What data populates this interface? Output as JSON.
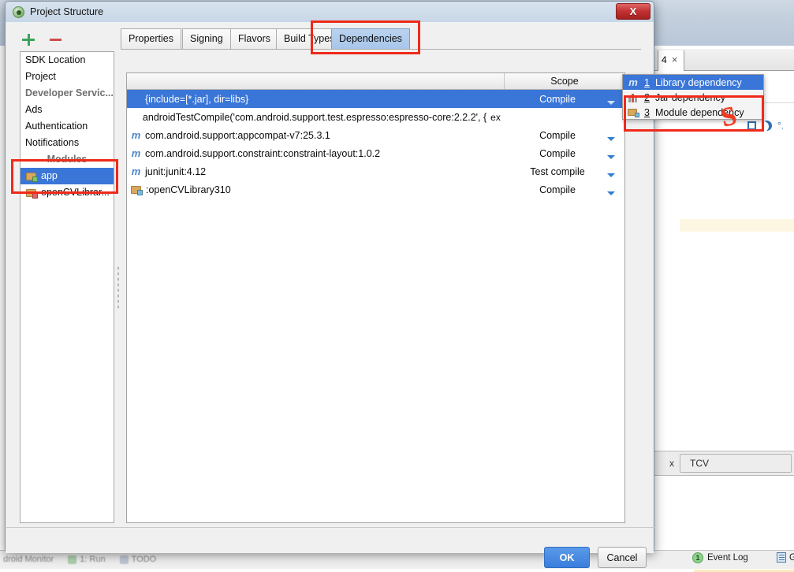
{
  "dialog": {
    "title": "Project Structure",
    "app_icon": "android-studio-icon",
    "close_label": "X",
    "toolbar": {
      "add_label": "+",
      "remove_label": "−"
    },
    "sidebar": {
      "items": [
        {
          "label": "SDK Location",
          "type": "item"
        },
        {
          "label": "Project",
          "type": "item"
        },
        {
          "label": "Developer Servic...",
          "type": "item-bold"
        },
        {
          "label": "Ads",
          "type": "item"
        },
        {
          "label": "Authentication",
          "type": "item"
        },
        {
          "label": "Notifications",
          "type": "item"
        }
      ],
      "group_label": "Modules",
      "modules": [
        {
          "label": "app",
          "selected": true,
          "icon": "module-app-icon"
        },
        {
          "label": "openCVLibrar...",
          "selected": false,
          "icon": "module-library-icon"
        }
      ]
    },
    "tabs": [
      {
        "label": "Properties",
        "active": false
      },
      {
        "label": "Signing",
        "active": false
      },
      {
        "label": "Flavors",
        "active": false
      },
      {
        "label": "Build Types",
        "active": false
      },
      {
        "label": "Dependencies",
        "active": true
      }
    ],
    "table": {
      "headers": {
        "name": "",
        "scope": "Scope"
      },
      "rows": [
        {
          "icon": "",
          "name": "{include=[*.jar], dir=libs}",
          "extra": "",
          "scope": "Compile",
          "selected": true,
          "has_caret": true
        },
        {
          "icon": "",
          "name": "androidTestCompile('com.android.support.test.espresso:espresso-core:2.2.2', {",
          "extra": "ex",
          "scope": "",
          "selected": false,
          "has_caret": false
        },
        {
          "icon": "m",
          "name": "com.android.support:appcompat-v7:25.3.1",
          "extra": "",
          "scope": "Compile",
          "selected": false,
          "has_caret": true
        },
        {
          "icon": "m",
          "name": "com.android.support.constraint:constraint-layout:1.0.2",
          "extra": "",
          "scope": "Compile",
          "selected": false,
          "has_caret": true
        },
        {
          "icon": "m",
          "name": "junit:junit:4.12",
          "extra": "",
          "scope": "Test compile",
          "selected": false,
          "has_caret": true
        },
        {
          "icon": "module",
          "name": ":openCVLibrary310",
          "extra": "",
          "scope": "Compile",
          "selected": false,
          "has_caret": true
        }
      ]
    },
    "add_button": {
      "label": "+",
      "icon": "plus-icon"
    },
    "popup_menu": {
      "items": [
        {
          "num": "1",
          "label": "Library dependency",
          "icon": "maven-icon",
          "selected": true
        },
        {
          "num": "2",
          "label": "Jar dependency",
          "icon": "jar-icon",
          "selected": false
        },
        {
          "num": "3",
          "label": "Module dependency",
          "icon": "module-icon",
          "selected": false
        }
      ]
    },
    "buttons": {
      "ok": "OK",
      "cancel": "Cancel"
    }
  },
  "background": {
    "editor_tab": {
      "label": "4",
      "close": "×"
    },
    "tool_window": {
      "value": "TCV",
      "close": "x"
    },
    "status": {
      "event_log": "Event Log",
      "event_count": "1",
      "gradle": "Gr"
    },
    "bottom_tabs": [
      {
        "label": "droid Monitor"
      },
      {
        "label": "1: Run"
      },
      {
        "label": "TODO"
      }
    ]
  },
  "annotations": {
    "boxes": [
      {
        "name": "dependencies-tab-highlight"
      },
      {
        "name": "modules-app-highlight"
      },
      {
        "name": "module-dependency-highlight"
      }
    ],
    "s_mark": "S"
  },
  "colors": {
    "accent_blue": "#3a76d8",
    "annotation_red": "#ef2a19",
    "tab_active": "#a8c6ea",
    "ok_button": "#3b7ddd"
  }
}
